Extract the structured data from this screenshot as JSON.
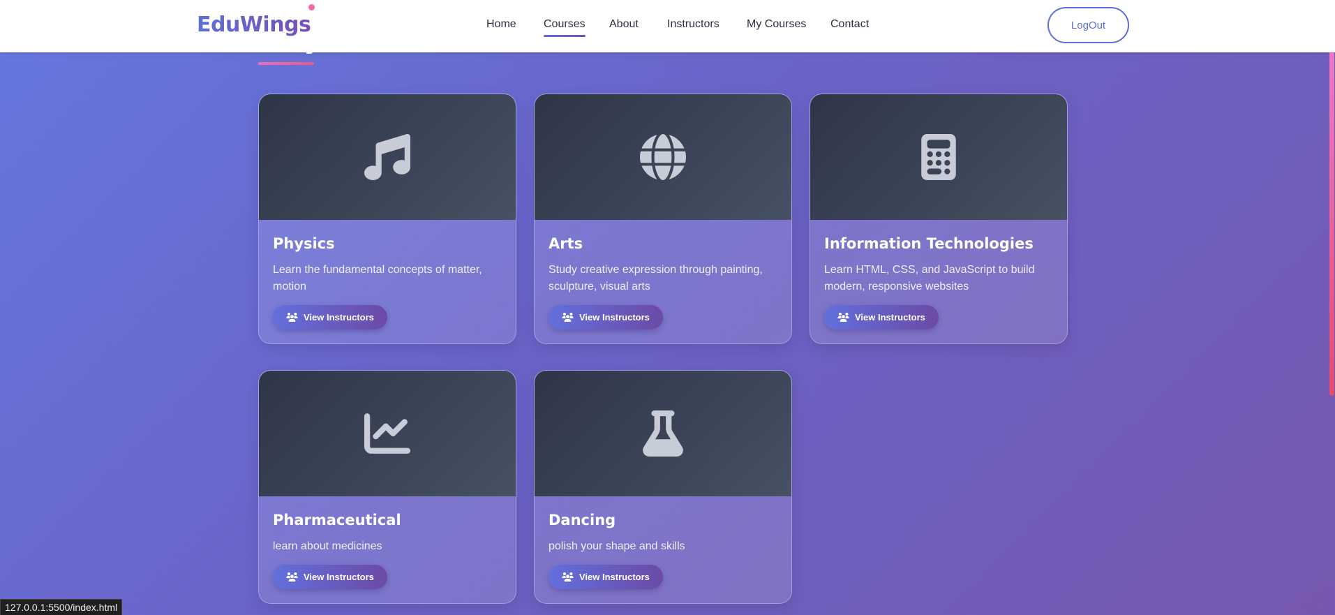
{
  "brand": {
    "name": "EduWings"
  },
  "nav": {
    "items": [
      {
        "label": "Home"
      },
      {
        "label": "Courses"
      },
      {
        "label": "About"
      },
      {
        "label": "Instructors"
      },
      {
        "label": "My Courses"
      },
      {
        "label": "Contact"
      }
    ],
    "active": "Courses",
    "logout_label": "LogOut"
  },
  "courses": [
    {
      "title": "Physics",
      "description": "Learn the fundamental concepts of matter, motion",
      "icon": "music-icon",
      "button_label": "View Instructors"
    },
    {
      "title": "Arts",
      "description": "Study creative expression through painting, sculpture, visual arts",
      "icon": "globe-icon",
      "button_label": "View Instructors"
    },
    {
      "title": "Information Technologies",
      "description": "Learn HTML, CSS, and JavaScript to build modern, responsive websites",
      "icon": "calculator-icon",
      "button_label": "View Instructors"
    },
    {
      "title": "Pharmaceutical",
      "description": "learn about medicines",
      "icon": "chart-line-icon",
      "button_label": "View Instructors"
    },
    {
      "title": "Dancing",
      "description": "polish your shape and skills",
      "icon": "flask-icon",
      "button_label": "View Instructors"
    }
  ],
  "status_bar": {
    "url": "127.0.0.1:5500/index.html"
  },
  "colors": {
    "accent": "#5c6fd6",
    "accent_secondary": "#7a4fb2",
    "card_header": "#3a4356",
    "highlight": "#f06aa8"
  }
}
